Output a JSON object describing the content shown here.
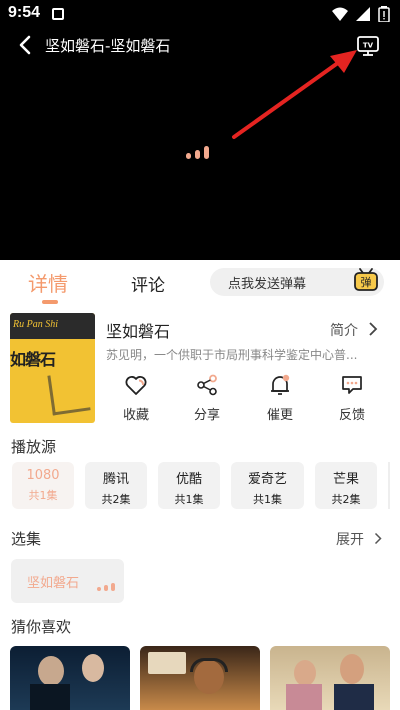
{
  "status_bar": {
    "time": "9:54"
  },
  "player": {
    "title": "坚如磐石-坚如磐石",
    "cast_button": "TV"
  },
  "tabs": {
    "details": "详情",
    "comments": "评论",
    "danmu_placeholder": "点我发送弹幕",
    "danmu_icon_text": "弹"
  },
  "show": {
    "poster_en": "Ru Pan Shi",
    "poster_cn": "如磐石",
    "title": "坚如磐石",
    "intro_label": "简介",
    "synopsis": "苏见明，一个供职于市局刑事科学鉴定中心普..."
  },
  "actions": [
    {
      "label": "收藏",
      "icon": "heart-icon"
    },
    {
      "label": "分享",
      "icon": "share-icon"
    },
    {
      "label": "催更",
      "icon": "bell-icon"
    },
    {
      "label": "反馈",
      "icon": "feedback-icon"
    }
  ],
  "sources": {
    "title": "播放源",
    "items": [
      {
        "name": "1080",
        "count": "共1集"
      },
      {
        "name": "腾讯",
        "count": "共2集"
      },
      {
        "name": "优酷",
        "count": "共1集"
      },
      {
        "name": "爱奇艺",
        "count": "共1集"
      },
      {
        "name": "芒果",
        "count": "共2集"
      }
    ]
  },
  "episodes": {
    "title": "选集",
    "expand": "展开",
    "items": [
      {
        "name": "坚如磐石"
      }
    ]
  },
  "recommend": {
    "title": "猜你喜欢"
  },
  "colors": {
    "accent": "#f49a6d",
    "arrow": "#e52421"
  }
}
